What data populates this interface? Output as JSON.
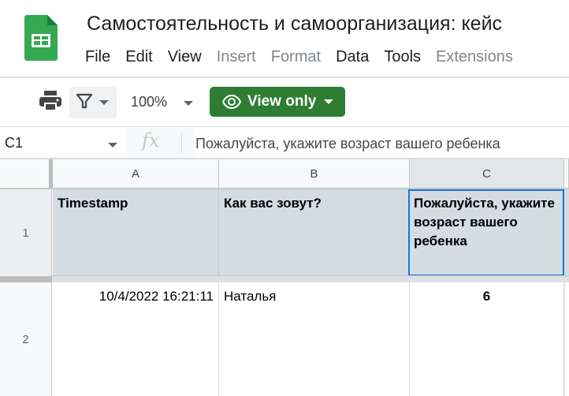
{
  "app": {
    "name": "Google Sheets",
    "doc_title": "Самостоятельность и самоорганизация: кейс",
    "brand_color": "#34a853",
    "accent_color": "#2e7d32",
    "selection_color": "#1a73e8"
  },
  "menu": [
    {
      "label": "File",
      "enabled": true
    },
    {
      "label": "Edit",
      "enabled": true
    },
    {
      "label": "View",
      "enabled": true
    },
    {
      "label": "Insert",
      "enabled": false
    },
    {
      "label": "Format",
      "enabled": false
    },
    {
      "label": "Data",
      "enabled": true
    },
    {
      "label": "Tools",
      "enabled": true
    },
    {
      "label": "Extensions",
      "enabled": false
    }
  ],
  "toolbar": {
    "print_icon": "printer-icon",
    "filter_icon": "filter-icon",
    "zoom": "100%",
    "view_only_label": "View only",
    "view_only_icon": "eye-icon"
  },
  "formula_bar": {
    "name_box": "C1",
    "fx_label": "fx",
    "content": "Пожалуйста, укажите возраст вашего ребенка"
  },
  "grid": {
    "columns": [
      "A",
      "B",
      "C"
    ],
    "selected_column": "C",
    "rows": [
      {
        "number": "1",
        "cells": [
          "Timestamp",
          "Как вас зовут?",
          "Пожалуйста, укажите возраст вашего ребенка"
        ]
      },
      {
        "number": "2",
        "cells": [
          "10/4/2022 16:21:11",
          "Наталья",
          "6"
        ]
      }
    ]
  }
}
